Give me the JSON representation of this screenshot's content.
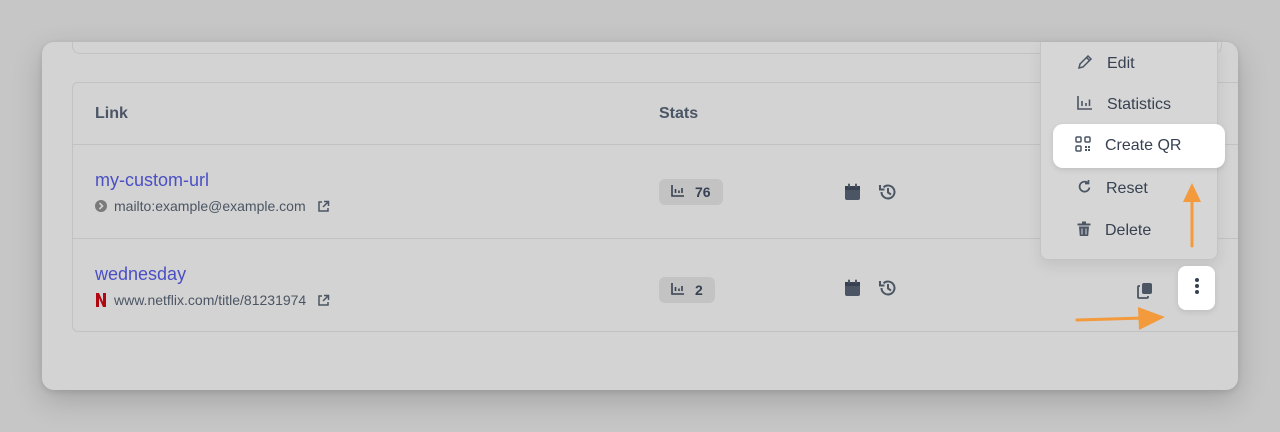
{
  "table": {
    "columns": [
      {
        "label": "Link"
      },
      {
        "label": "Stats"
      }
    ],
    "rows": [
      {
        "slug": "my-custom-url",
        "target": "mailto:example@example.com",
        "favicon": "chevron-circle-icon",
        "visits": "76"
      },
      {
        "slug": "wednesday",
        "target": "www.netflix.com/title/81231974",
        "favicon": "netflix-logo-icon",
        "visits": "2"
      }
    ]
  },
  "menu": {
    "items": [
      {
        "label": "Edit",
        "icon": "pencil-icon"
      },
      {
        "label": "Statistics",
        "icon": "bar-chart-icon"
      },
      {
        "label": "Create QR",
        "icon": "qr-code-icon",
        "highlighted": true
      },
      {
        "label": "Reset",
        "icon": "reset-icon"
      },
      {
        "label": "Delete",
        "icon": "trash-icon"
      }
    ]
  },
  "colors": {
    "background": "#c6c6c6",
    "panel": "#d3d3d3",
    "link": "#4a4fc4",
    "arrow": "#f29a3c",
    "netflix": "#b20710"
  }
}
